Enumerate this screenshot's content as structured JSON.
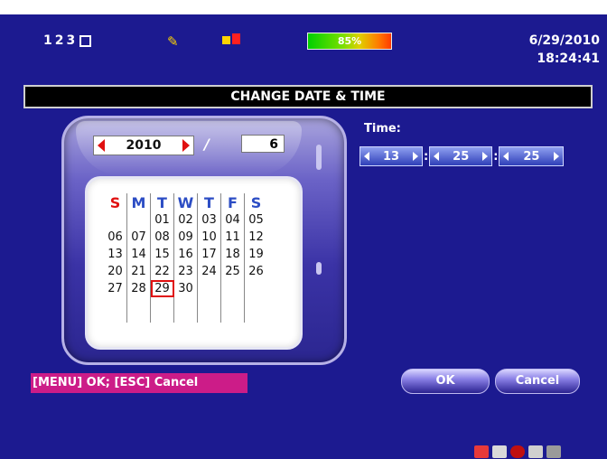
{
  "status": {
    "channels": "123",
    "hdd_percent": "85%",
    "hdd_fill": 0.85,
    "date": "6/29/2010",
    "time": "18:24:41"
  },
  "dialog": {
    "title": "CHANGE DATE & TIME",
    "year": "2010",
    "separator": "/",
    "month": "6",
    "weekdays": [
      "S",
      "M",
      "T",
      "W",
      "T",
      "F",
      "S"
    ],
    "days": [
      [
        "",
        "",
        "01",
        "02",
        "03",
        "04",
        "05"
      ],
      [
        "06",
        "07",
        "08",
        "09",
        "10",
        "11",
        "12"
      ],
      [
        "13",
        "14",
        "15",
        "16",
        "17",
        "18",
        "19"
      ],
      [
        "20",
        "21",
        "22",
        "23",
        "24",
        "25",
        "26"
      ],
      [
        "27",
        "28",
        "29",
        "30",
        "",
        "",
        ""
      ]
    ],
    "selected_day": "29",
    "time_label": "Time:",
    "hour": "13",
    "minute": "25",
    "second": "25",
    "time_sep": ":"
  },
  "footer": {
    "hint": "[MENU] OK; [ESC] Cancel",
    "ok_label": "OK",
    "cancel_label": "Cancel"
  },
  "colors": {
    "background": "#1c1a90",
    "sunday": "#e01010",
    "weekday": "#2c4dc4",
    "hint_bg": "#cc1c88"
  }
}
